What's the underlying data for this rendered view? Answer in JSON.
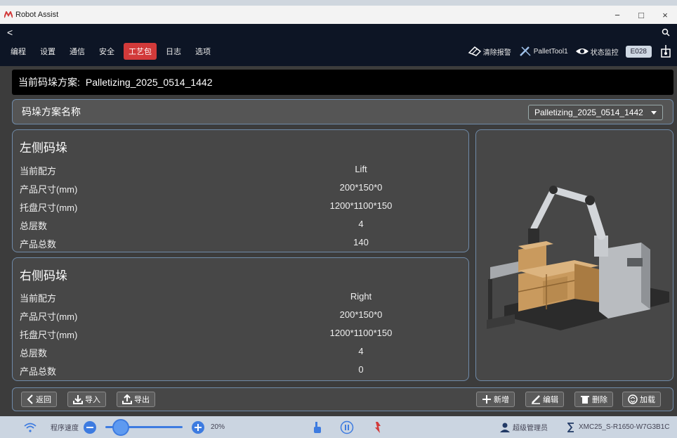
{
  "window": {
    "title": "Robot Assist",
    "minimize": "−",
    "maximize": "□",
    "close": "×"
  },
  "nav": {
    "back": "<",
    "menu": [
      "编程",
      "设置",
      "通信",
      "安全",
      "工艺包",
      "日志",
      "选项"
    ],
    "active_menu": "工艺包",
    "tools": {
      "clear_alarm": "清除报警",
      "pallet_tool": "PalletTool1",
      "status_monitor": "状态监控",
      "error_code": "E028"
    }
  },
  "scheme": {
    "label": "当前码垛方案:",
    "value": "Palletizing_2025_0514_1442"
  },
  "scheme_name": {
    "label": "码垛方案名称",
    "selected": "Palletizing_2025_0514_1442"
  },
  "left_stack": {
    "title": "左侧码垛",
    "rows": [
      {
        "key": "当前配方",
        "value": "Lift"
      },
      {
        "key": "产品尺寸(mm)",
        "value": "200*150*0"
      },
      {
        "key": "托盘尺寸(mm)",
        "value": "1200*1100*150"
      },
      {
        "key": "总层数",
        "value": "4"
      },
      {
        "key": "产品总数",
        "value": "140"
      }
    ]
  },
  "right_stack": {
    "title": "右侧码垛",
    "rows": [
      {
        "key": "当前配方",
        "value": "Right"
      },
      {
        "key": "产品尺寸(mm)",
        "value": "200*150*0"
      },
      {
        "key": "托盘尺寸(mm)",
        "value": "1200*1100*150"
      },
      {
        "key": "总层数",
        "value": "4"
      },
      {
        "key": "产品总数",
        "value": "0"
      }
    ]
  },
  "actions": {
    "back": "返回",
    "import": "导入",
    "export": "导出",
    "add": "新增",
    "edit": "编辑",
    "delete": "删除",
    "load": "加载"
  },
  "status": {
    "program_speed_label": "程序速度",
    "speed_value": "20%",
    "speed_fraction": 0.2,
    "user": "超级管理员",
    "device": "XMC25_S-R1650-W7G3B1C"
  },
  "colors": {
    "accent_red": "#d23a3a",
    "panel_border": "#6f8aa8",
    "appbar_bg": "#0d1525",
    "status_blue": "#3d7be0"
  }
}
